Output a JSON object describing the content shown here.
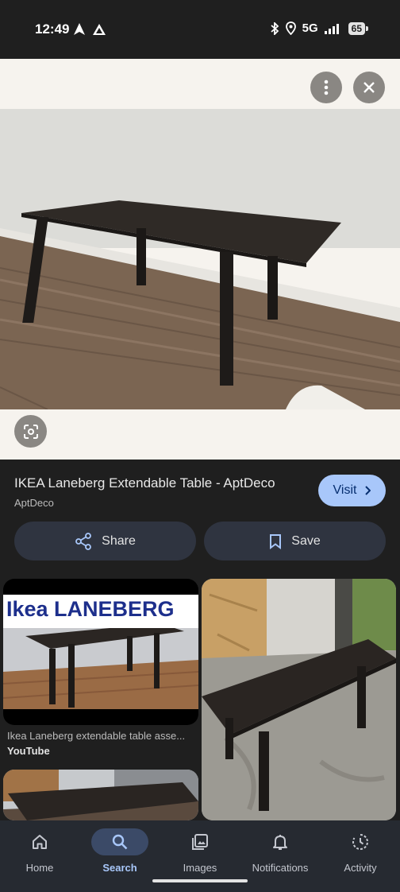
{
  "status_bar": {
    "time": "12:49",
    "network": "5G",
    "battery": "65"
  },
  "result": {
    "title": "IKEA Laneberg Extendable Table - AptDeco",
    "source": "AptDeco",
    "visit_label": "Visit"
  },
  "actions": {
    "share_label": "Share",
    "save_label": "Save"
  },
  "grid": [
    {
      "banner": "Ikea LANEBERG",
      "caption": "Ikea Laneberg extendable table asse...",
      "source": "YouTube"
    }
  ],
  "nav": [
    {
      "label": "Home",
      "icon": "home-icon"
    },
    {
      "label": "Search",
      "icon": "search-icon"
    },
    {
      "label": "Images",
      "icon": "images-icon"
    },
    {
      "label": "Notifications",
      "icon": "bell-icon"
    },
    {
      "label": "Activity",
      "icon": "activity-icon"
    }
  ],
  "colors": {
    "accent": "#a8c7fa",
    "background": "#1f1f1f",
    "button_bg": "#2f3440"
  }
}
